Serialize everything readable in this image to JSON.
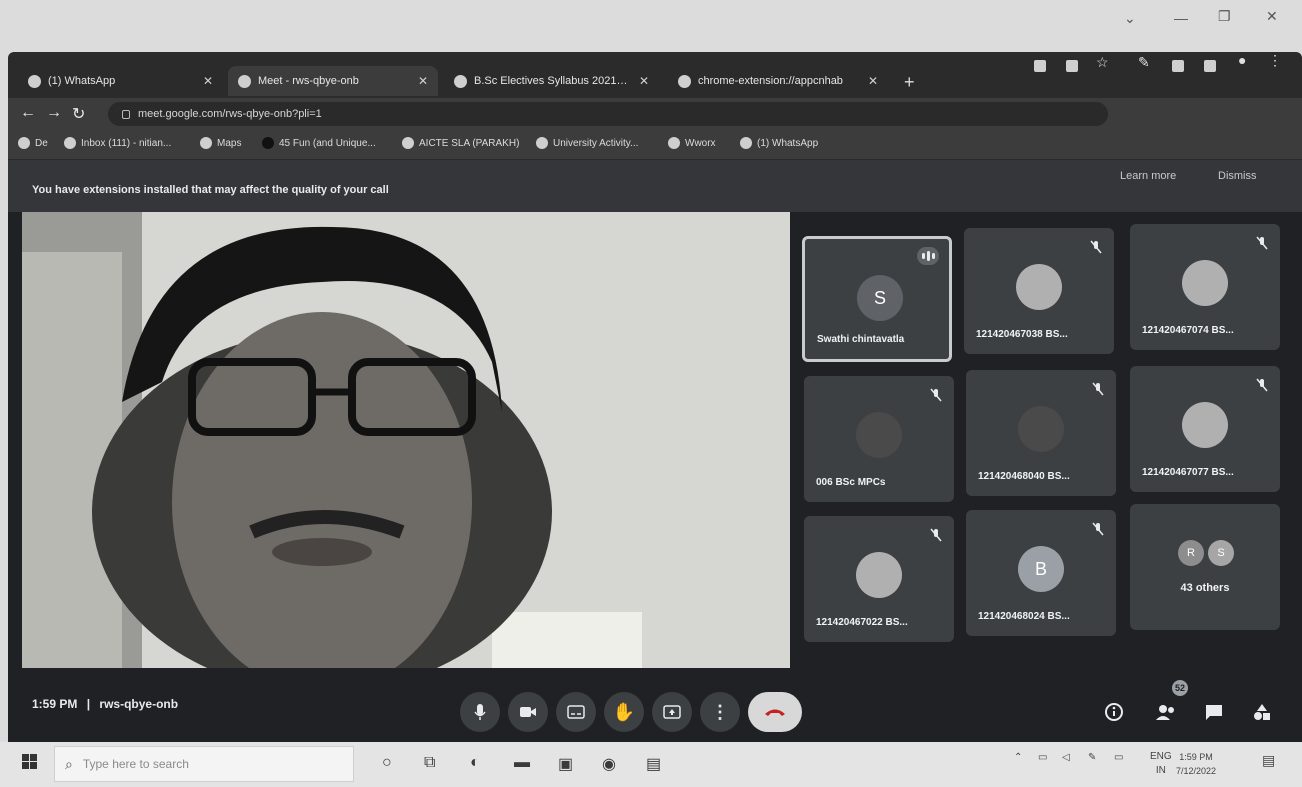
{
  "browser": {
    "tabs": [
      {
        "label": "(1) WhatsApp",
        "active": false
      },
      {
        "label": "Meet - rws-qbye-onb",
        "active": true
      },
      {
        "label": "B.Sc Electives Syllabus 2021-202",
        "active": false
      },
      {
        "label": "chrome-extension://appcnhab",
        "active": false
      }
    ],
    "new_tab": "+",
    "window_controls": [
      "⌄",
      "—",
      "❐",
      "✕"
    ],
    "url": "meet.google.com/rws-qbye-onb?pli=1",
    "bookmarks": [
      "De",
      "Inbox (111) - nitian...",
      "Maps",
      "45 Fun (and Unique...",
      "AICTE SLA (PARAKH)",
      "University Activity...",
      "Wworx",
      "(1) WhatsApp"
    ]
  },
  "meet": {
    "banner": {
      "message": "You have extensions installed that may affect the quality of your call",
      "learn_more": "Learn more",
      "dismiss": "Dismiss"
    },
    "participants": [
      {
        "name": "Swathi chintavatla",
        "avatar": "S",
        "avatar_type": "letter",
        "speaking": true,
        "muted": false
      },
      {
        "name": "121420467038 BS...",
        "avatar": "",
        "avatar_type": "photo",
        "speaking": false,
        "muted": true
      },
      {
        "name": "121420467074 BS...",
        "avatar": "",
        "avatar_type": "photo",
        "speaking": false,
        "muted": true
      },
      {
        "name": "006 BSc MPCs",
        "avatar": "",
        "avatar_type": "dark",
        "speaking": false,
        "muted": true
      },
      {
        "name": "121420468040 BS...",
        "avatar": "",
        "avatar_type": "dark",
        "speaking": false,
        "muted": true
      },
      {
        "name": "121420467077 BS...",
        "avatar": "",
        "avatar_type": "photo",
        "speaking": false,
        "muted": true
      },
      {
        "name": "121420467022 BS...",
        "avatar": "",
        "avatar_type": "photo",
        "speaking": false,
        "muted": true
      },
      {
        "name": "121420468024 BS...",
        "avatar": "B",
        "avatar_type": "letter",
        "speaking": false,
        "muted": true
      }
    ],
    "others": {
      "label": "43 others",
      "avatars": [
        "R",
        "S"
      ]
    },
    "time": "1:59 PM",
    "separator": "|",
    "meeting_code": "rws-qbye-onb",
    "people_count": "52",
    "controls": [
      "mic-icon",
      "camera-icon",
      "captions-icon",
      "raise-hand-icon",
      "present-icon",
      "more-icon",
      "end-call-icon"
    ]
  },
  "taskbar": {
    "search_placeholder": "Type here to search",
    "language": "ENG",
    "region": "IN",
    "time": "1:59 PM",
    "date": "7/12/2022"
  }
}
